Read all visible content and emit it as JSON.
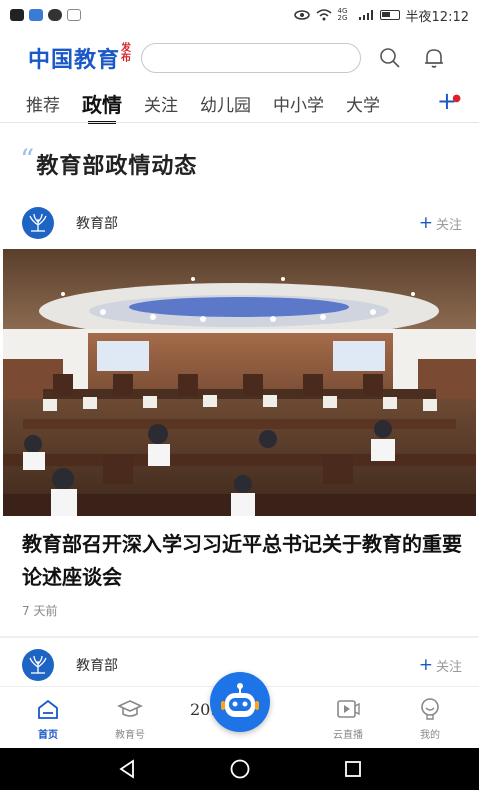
{
  "status_bar": {
    "network": "4G 2G",
    "time": "半夜12:12"
  },
  "header": {
    "logo_main": "中国教育",
    "logo_sub_1": "发",
    "logo_sub_2": "布",
    "search_placeholder": ""
  },
  "tabs": [
    {
      "label": "推荐"
    },
    {
      "label": "政情"
    },
    {
      "label": "关注"
    },
    {
      "label": "幼儿园"
    },
    {
      "label": "中小学"
    },
    {
      "label": "大学"
    }
  ],
  "section": {
    "title": "教育部政情动态"
  },
  "author_top": {
    "name": "教育部",
    "follow": "关注"
  },
  "article": {
    "headline": "教育部召开深入学习习近平总书记关于教育的重要论述座谈会",
    "time": "7 天前"
  },
  "author_bottom": {
    "name": "教育部",
    "follow": "关注"
  },
  "bottom_nav": {
    "items": [
      {
        "label": "首页",
        "icon": "home-icon"
      },
      {
        "label": "教育号",
        "icon": "graduation-cap-icon"
      },
      {
        "label": "云直播",
        "icon": "video-play-icon"
      },
      {
        "label": "我的",
        "icon": "profile-icon"
      }
    ],
    "ghost_text": "20… 国"
  },
  "colors": {
    "brand_blue": "#1a57c7",
    "accent_red": "#d8232a",
    "fab_blue": "#1e73e6"
  }
}
